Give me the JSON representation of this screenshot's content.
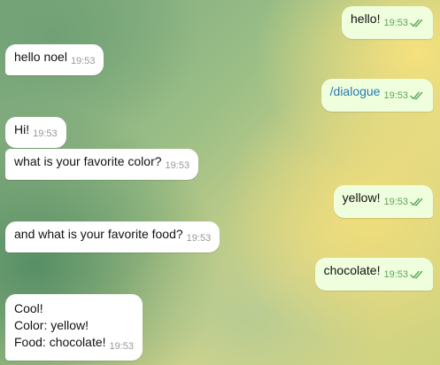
{
  "messages": [
    {
      "dir": "out",
      "text": "hello!",
      "time": "19:53"
    },
    {
      "dir": "in",
      "text": "hello noel",
      "time": "19:53"
    },
    {
      "dir": "out",
      "text": "/dialogue",
      "time": "19:53"
    },
    {
      "dir": "in",
      "text": "Hi!",
      "time": "19:53"
    },
    {
      "dir": "in",
      "text": "what is your favorite color?",
      "time": "19:53"
    },
    {
      "dir": "out",
      "text": "yellow!",
      "time": "19:53"
    },
    {
      "dir": "in",
      "text": "and what is your favorite food?",
      "time": "19:53"
    },
    {
      "dir": "out",
      "text": "chocolate!",
      "time": "19:53"
    },
    {
      "dir": "in",
      "lines": [
        "Cool!",
        "Color: yellow!",
        "Food: chocolate!"
      ],
      "time": "19:53"
    }
  ],
  "colors": {
    "incoming_bubble": "#ffffff",
    "outgoing_bubble": "#effedd",
    "read_ticks": "#5fa55a",
    "command_link": "#2a7ab0"
  },
  "icons": {
    "read_status": "double-check-icon"
  }
}
